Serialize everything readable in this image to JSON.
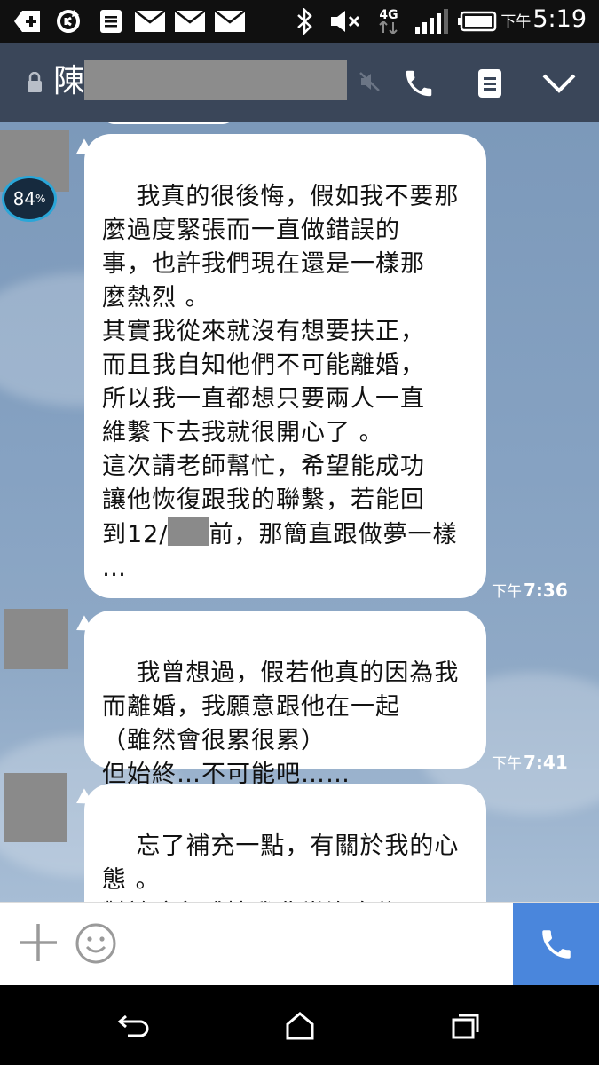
{
  "status_bar": {
    "ampm": "下午",
    "time": "5:19",
    "network": "4G",
    "icons": [
      "add-icon",
      "sync-icon",
      "note-icon",
      "mail-icon",
      "mail-icon",
      "mail-icon",
      "bluetooth-icon",
      "mute-icon",
      "signal-icon",
      "battery-icon"
    ]
  },
  "header": {
    "contact_name": "陳",
    "icons": [
      "lock-icon",
      "mute-icon",
      "call-icon",
      "notes-icon",
      "chevron-down-icon"
    ]
  },
  "chat": {
    "battery_badge": {
      "value": "84",
      "unit": "%"
    },
    "messages": [
      {
        "text_before": "我真的很後悔，假如我不要那\n麼過度緊張而一直做錯誤的\n事，也許我們現在還是一樣那\n麼熱烈 。\n其實我從來就沒有想要扶正，\n而且我自知他們不可能離婚，\n所以我一直都想只要兩人一直\n維繫下去我就很開心了 。\n這次請老師幫忙，希望能成功\n讓他恢復跟我的聯繫，若能回\n到12/",
        "text_after": "前，那簡直跟做夢一樣\n…",
        "ampm": "下午",
        "time": "7:36"
      },
      {
        "text": "我曾想過，假若他真的因為我\n而離婚，我願意跟他在一起\n（雖然會很累很累）\n但始終…不可能吧……",
        "ampm": "下午",
        "time": "7:41"
      },
      {
        "text": "忘了補充一點，有關於我的心\n態 。\n對於這段感情我非常沒自信，\n"
      }
    ]
  },
  "input_bar": {
    "icons": [
      "plus-icon",
      "emoji-icon",
      "call-icon"
    ]
  },
  "nav_bar": {
    "icons": [
      "back-icon",
      "home-icon",
      "recents-icon"
    ]
  },
  "colors": {
    "header_bg": "#3a4659",
    "chat_bg": "#7f9cbc",
    "call_button": "#4a86dc",
    "bubble": "#ffffff"
  }
}
